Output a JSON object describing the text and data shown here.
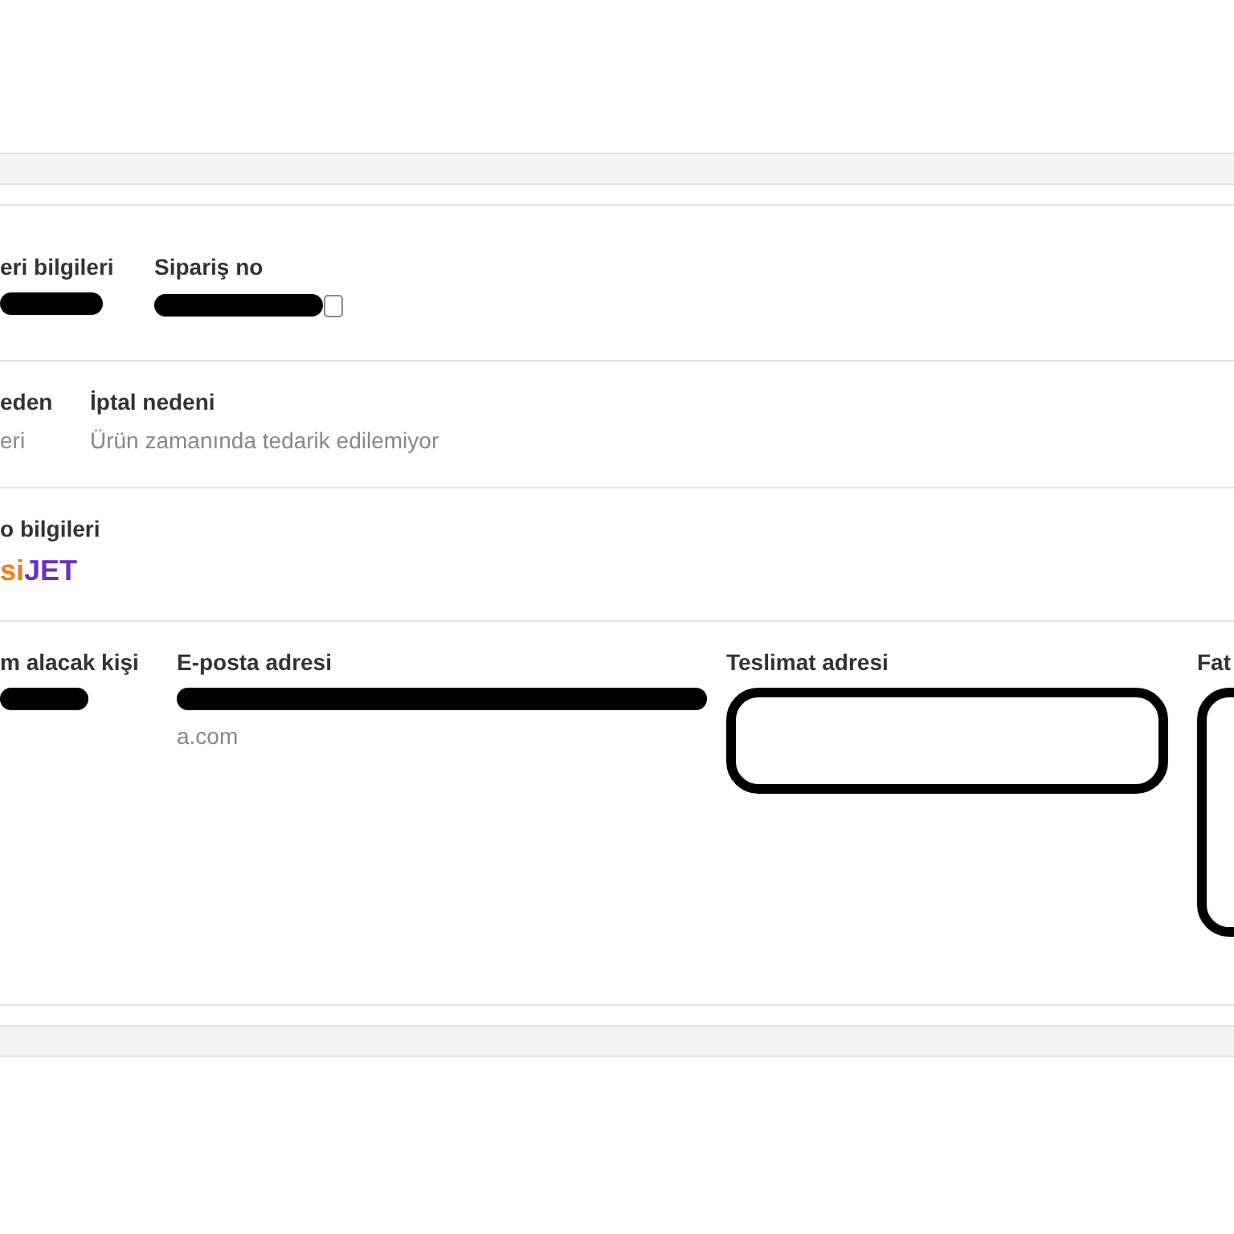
{
  "sections": [
    {
      "fields": [
        {
          "label": "eri bilgileri",
          "kind": "bar"
        },
        {
          "label": "Sipariş no",
          "kind": "bar",
          "copyable": true
        }
      ]
    },
    {
      "fields": [
        {
          "label": "eden",
          "kind": "text",
          "value": "eri"
        },
        {
          "label": "İptal nedeni",
          "kind": "text",
          "value": "Ürün zamanında tedarik edilemiyor"
        }
      ]
    },
    {
      "fields": [
        {
          "label": "o bilgileri",
          "kind": "logo",
          "logo": {
            "first": "si",
            "second": "JET"
          }
        }
      ]
    },
    {
      "fields": [
        {
          "label": "m alacak kişi",
          "kind": "bar"
        },
        {
          "label": "E-posta adresi",
          "kind": "bar",
          "value": "a.com"
        },
        {
          "label": "Teslimat adresi",
          "kind": "outline"
        },
        {
          "label": "Fat",
          "kind": "outline"
        }
      ]
    }
  ]
}
